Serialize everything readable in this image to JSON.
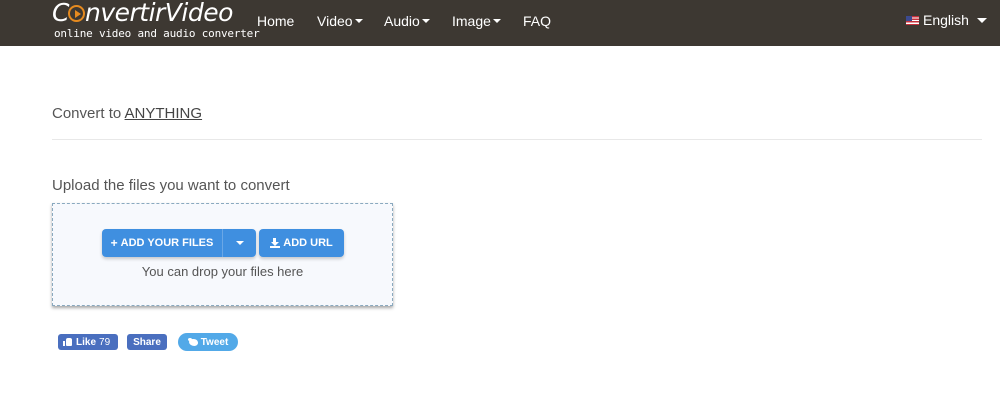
{
  "header": {
    "logo": {
      "title_prefix": "C",
      "title_rest": "nvertirVideo",
      "subtitle": "online video and audio converter"
    },
    "nav": [
      {
        "label": "Home",
        "has_caret": false
      },
      {
        "label": "Video",
        "has_caret": true
      },
      {
        "label": "Audio",
        "has_caret": true
      },
      {
        "label": "Image",
        "has_caret": true
      },
      {
        "label": "FAQ",
        "has_caret": false
      }
    ],
    "language": {
      "label": "English",
      "flag_icon": "us-flag-icon"
    }
  },
  "main": {
    "convert_prefix": "Convert to ",
    "convert_target": "ANYTHING",
    "upload_title": "Upload the files you want to convert",
    "dropzone": {
      "add_files_label": "ADD YOUR FILES",
      "add_url_label": "ADD URL",
      "drop_hint": "You can drop your files here"
    }
  },
  "social": {
    "like_label": "Like",
    "like_count": "79",
    "share_label": "Share",
    "tweet_label": "Tweet"
  },
  "colors": {
    "header_bg": "#3d3832",
    "logo_accent": "#e58a1f",
    "button_blue": "#3f8fe0",
    "facebook_blue": "#4a6fbf",
    "twitter_blue": "#52a9e8"
  }
}
